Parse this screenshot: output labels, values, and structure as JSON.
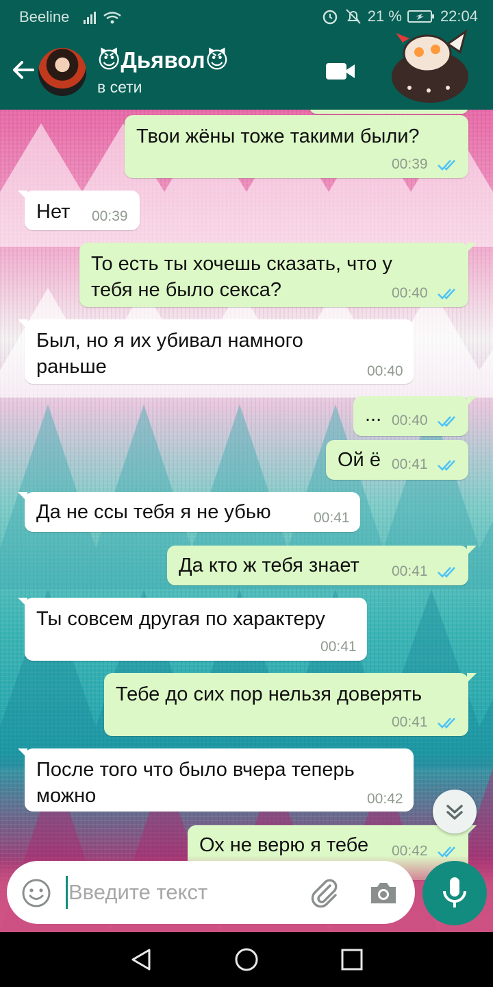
{
  "status_bar": {
    "carrier": "Beeline",
    "battery": "21 %",
    "time": "22:04"
  },
  "header": {
    "contact_name": "😈Дьявол😈",
    "contact_status": "в сети"
  },
  "messages": [
    {
      "dir": "out",
      "text": "Твои жёны тоже такими были?",
      "time": "00:39"
    },
    {
      "dir": "in",
      "text": "Нет",
      "time": "00:39"
    },
    {
      "dir": "out",
      "text_l1": "То есть ты хочешь сказать, что у",
      "text_l2": "тебя не было секса?",
      "time": "00:40"
    },
    {
      "dir": "in",
      "text_l1": "Был, но я их убивал намного",
      "text_l2": "раньше",
      "time": "00:40"
    },
    {
      "dir": "out",
      "text": "...",
      "time": "00:40"
    },
    {
      "dir": "out",
      "text": "Ой ё",
      "time": "00:41"
    },
    {
      "dir": "in",
      "text": "Да не ссы тебя я не убью",
      "time": "00:41"
    },
    {
      "dir": "out",
      "text": "Да кто ж тебя знает",
      "time": "00:41"
    },
    {
      "dir": "in",
      "text": "Ты совсем другая по характеру",
      "time": "00:41"
    },
    {
      "dir": "out",
      "text": "Тебе до сих пор нельзя доверять",
      "time": "00:41"
    },
    {
      "dir": "in",
      "text_l1": "После того что было вчера теперь",
      "text_l2": "можно",
      "time": "00:42"
    },
    {
      "dir": "out",
      "text": "Ох не верю я тебе",
      "time": "00:42"
    }
  ],
  "input": {
    "placeholder": "Введите текст"
  },
  "icons": {
    "back": "arrow-left-icon",
    "video": "video-call-icon",
    "emoji": "emoji-icon",
    "attach": "paperclip-icon",
    "camera": "camera-icon",
    "mic": "microphone-icon",
    "scroll": "double-chevron-down-icon",
    "ticks": "double-check-icon"
  },
  "colors": {
    "header": "#075e54",
    "outgoing_bubble": "#dcf8c6",
    "incoming_bubble": "#ffffff",
    "accent": "#128c7e",
    "read_ticks": "#4fc3f7"
  }
}
